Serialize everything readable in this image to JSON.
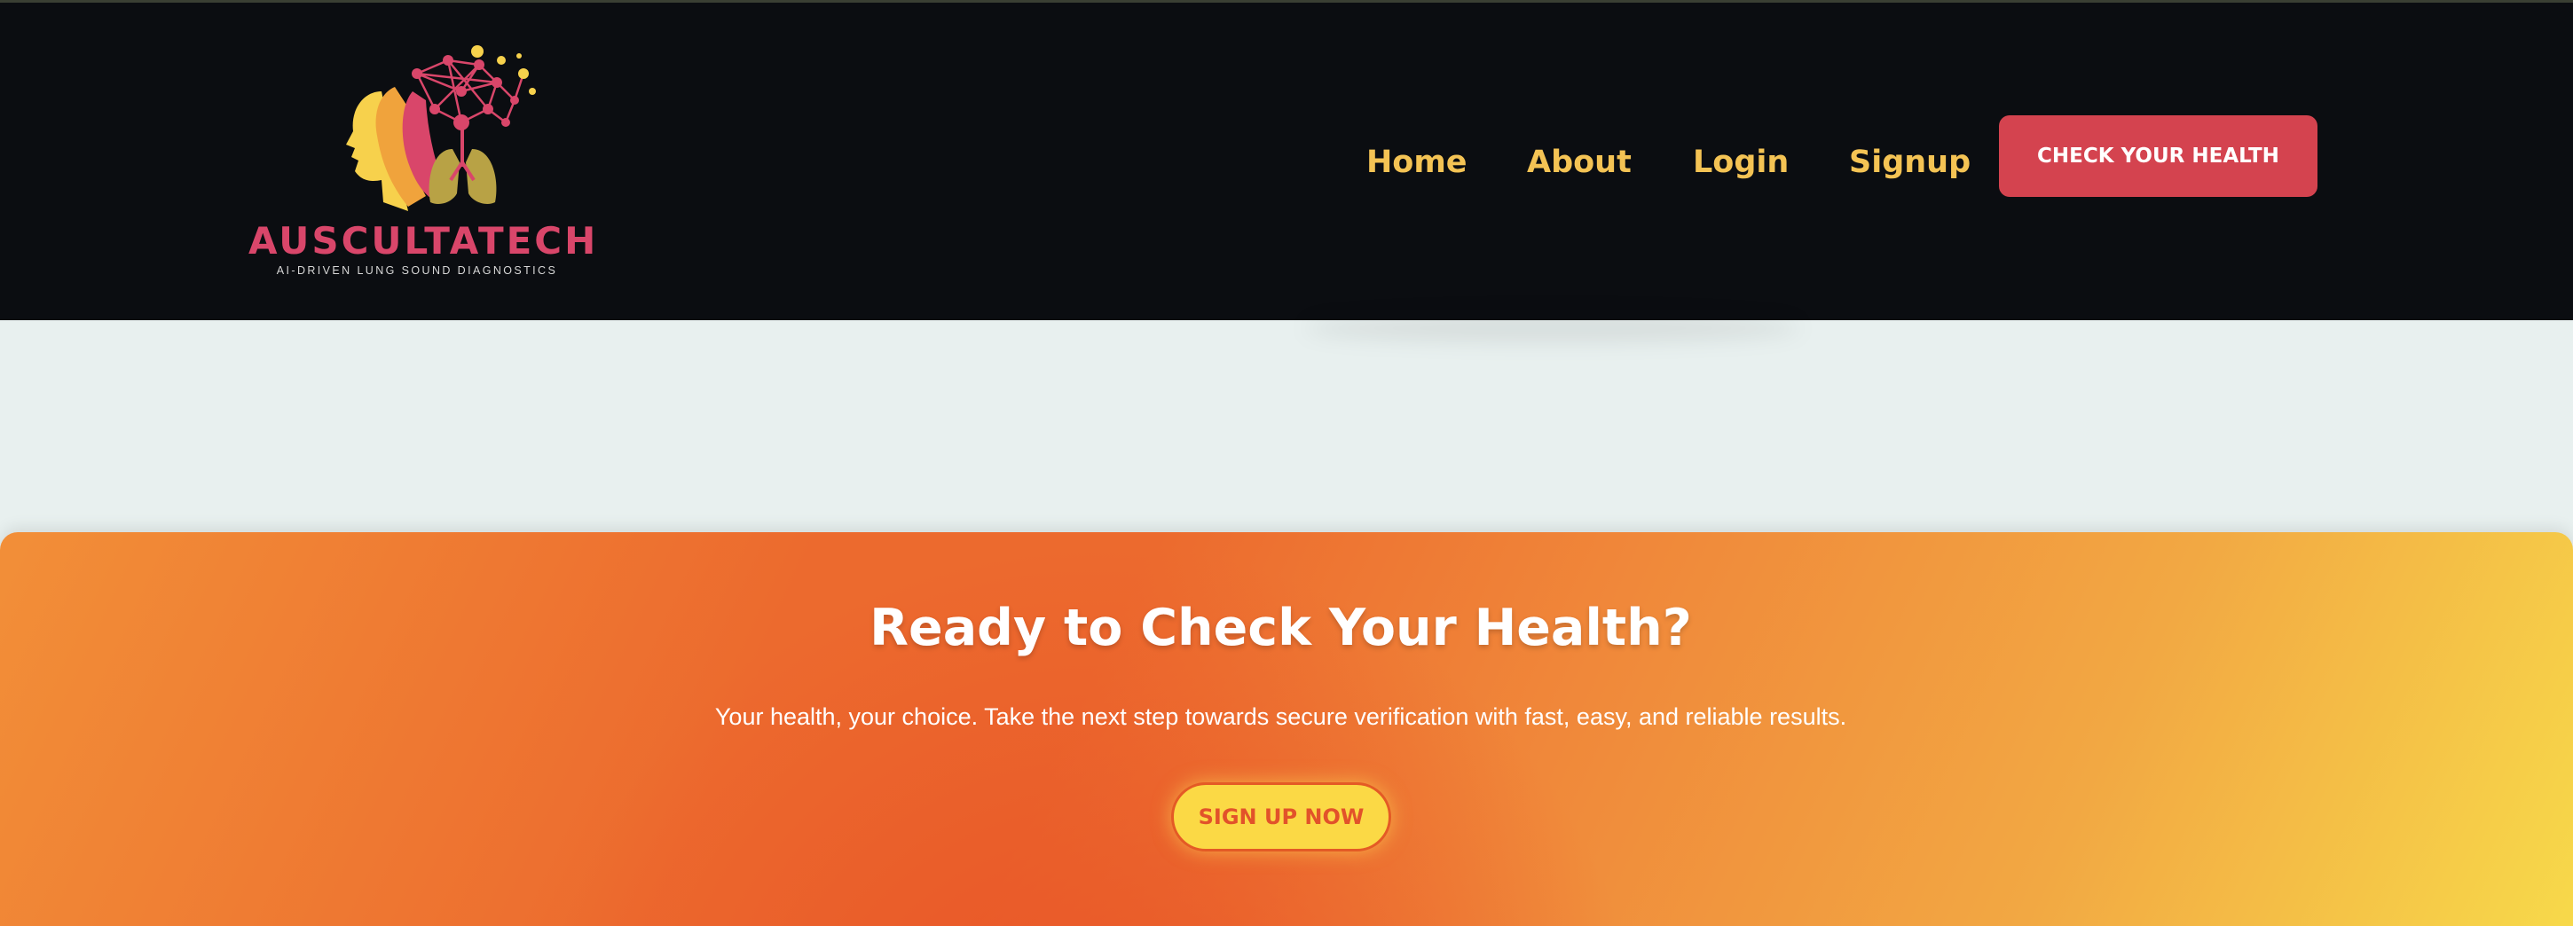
{
  "brand": {
    "name": "AUSCULTATECH",
    "tagline": "AI-DRIVEN LUNG SOUND DIAGNOSTICS"
  },
  "nav": {
    "items": [
      "Home",
      "About",
      "Login",
      "Signup"
    ],
    "cta": "CHECK YOUR HEALTH"
  },
  "banner": {
    "title": "Ready to Check Your Health?",
    "text": "Your health, your choice. Take the next step towards secure verification with fast, easy, and reliable results.",
    "button": "SIGN UP NOW"
  },
  "colors": {
    "header_bg": "#0b0d11",
    "nav_text": "#f4c354",
    "cta_bg": "#d4434f",
    "page_bg": "#e8f0ef",
    "banner_orange": "#ec6a2e",
    "banner_yellow": "#f7d94a",
    "signup_btn_bg": "#fbd945",
    "brand_pink": "#d9466a"
  },
  "icons": {
    "logo": "head-with-lungs-network-logo"
  }
}
